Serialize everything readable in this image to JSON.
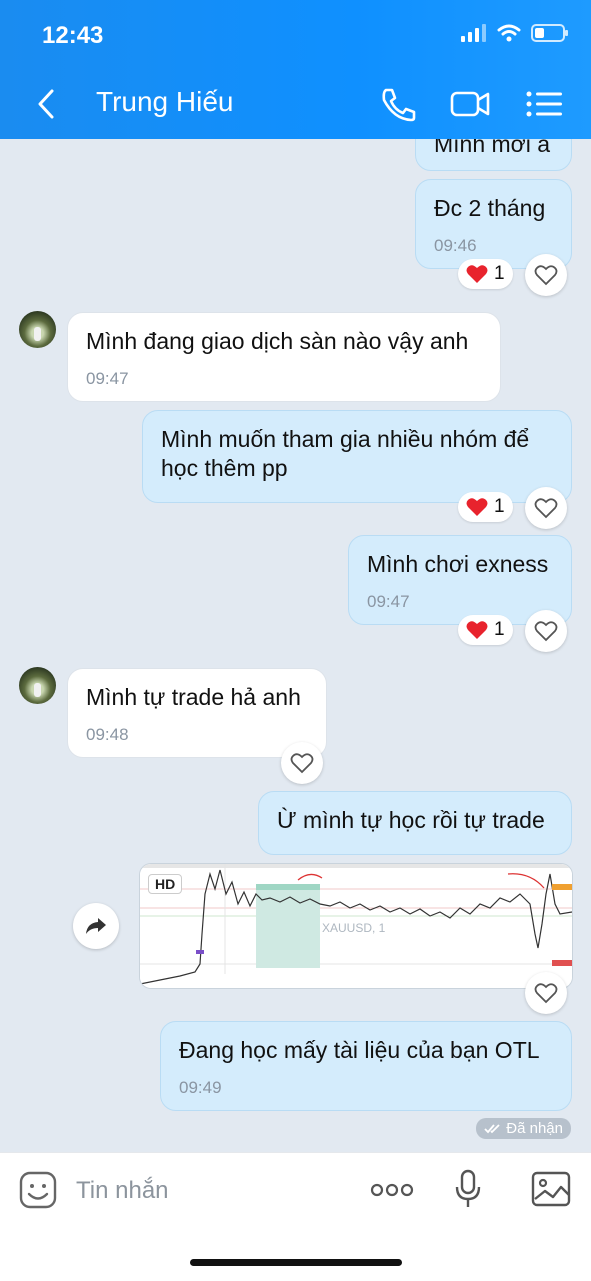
{
  "status_bar": {
    "time": "12:43"
  },
  "header": {
    "title": "Trung Hiếu"
  },
  "messages": {
    "m0": {
      "text": "Mình mới à"
    },
    "m1": {
      "text": "Đc 2 tháng",
      "time": "09:46",
      "reaction_count": "1"
    },
    "m2": {
      "text": "Mình đang giao dịch sàn nào vậy anh",
      "time": "09:47"
    },
    "m3": {
      "text": "Mình muốn tham gia nhiều nhóm để học thêm pp",
      "reaction_count": "1"
    },
    "m4": {
      "text": "Mình chơi exness",
      "time": "09:47",
      "reaction_count": "1"
    },
    "m5": {
      "text": "Mình tự trade hả anh",
      "time": "09:48"
    },
    "m6": {
      "text": "Ừ mình tự học rồi tự trade"
    },
    "m7": {
      "badge": "HD",
      "chart_label": "XAUUSD, 1"
    },
    "m8": {
      "text": "Đang học mấy tài liệu của bạn OTL",
      "time": "09:49"
    }
  },
  "status": {
    "received": "Đã nhận"
  },
  "input": {
    "placeholder": "Tin nhắn"
  },
  "colors": {
    "header": "#1a8cf0",
    "outgoing_bubble": "#d4ecfc",
    "incoming_bubble": "#ffffff",
    "heart": "#e8232d"
  }
}
